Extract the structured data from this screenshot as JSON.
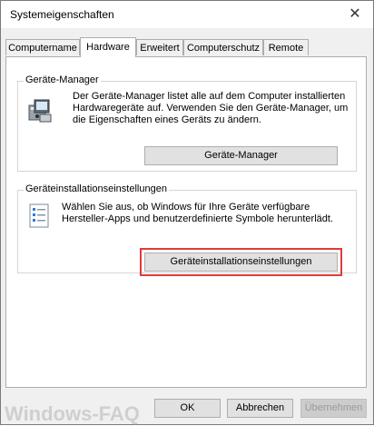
{
  "window": {
    "title": "Systemeigenschaften",
    "close_glyph": "✕"
  },
  "tabs": [
    {
      "label": "Computername",
      "active": false
    },
    {
      "label": "Hardware",
      "active": true
    },
    {
      "label": "Erweitert",
      "active": false
    },
    {
      "label": "Computerschutz",
      "active": false
    },
    {
      "label": "Remote",
      "active": false
    }
  ],
  "device_manager": {
    "group_label": "Geräte-Manager",
    "description_lines": [
      "Der Geräte-Manager listet alle auf dem Computer installierten",
      "Hardwaregeräte auf. Verwenden Sie den Geräte-Manager, um",
      "die Eigenschaften eines Geräts zu ändern."
    ],
    "button_label": "Geräte-Manager",
    "icon": "device-manager-icon"
  },
  "device_install": {
    "group_label": "Geräteinstallationseinstellungen",
    "description_lines": [
      "Wählen Sie aus, ob Windows für Ihre Geräte verfügbare",
      "Hersteller-Apps und benutzerdefinierte Symbole herunterlädt."
    ],
    "button_label": "Geräteinstallationseinstellungen",
    "icon": "checklist-icon",
    "highlight_color": "#e03b3b"
  },
  "footer": {
    "ok_label": "OK",
    "cancel_label": "Abbrechen",
    "apply_label": "Übernehmen"
  },
  "watermark": "Windows-FAQ"
}
